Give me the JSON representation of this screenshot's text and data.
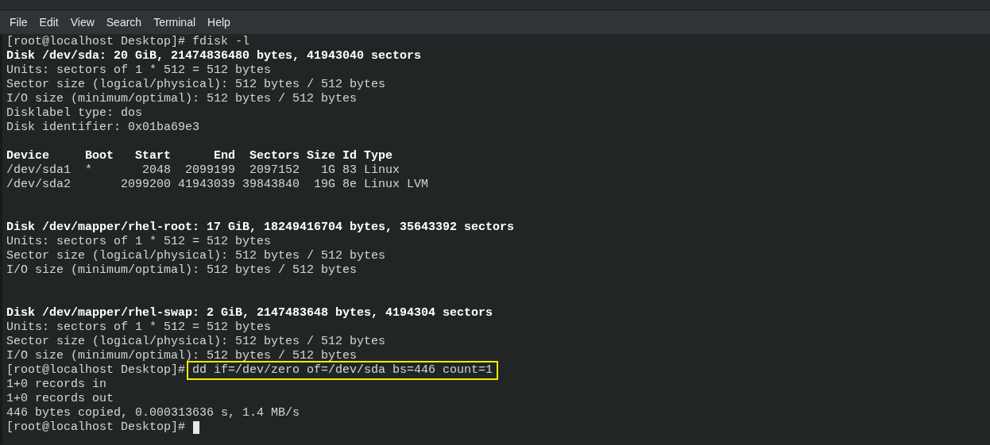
{
  "menu_bar": [
    {
      "label": "File"
    },
    {
      "label": "Edit"
    },
    {
      "label": "View"
    },
    {
      "label": "Search"
    },
    {
      "label": "Terminal"
    },
    {
      "label": "Help"
    }
  ],
  "terminal": {
    "lines": [
      {
        "kind": "prompt",
        "prompt": "[root@localhost Desktop]#",
        "command": "fdisk -l",
        "highlighted": false,
        "cursor": false
      },
      {
        "kind": "bold",
        "text": "Disk /dev/sda: 20 GiB, 21474836480 bytes, 41943040 sectors"
      },
      {
        "kind": "normal",
        "text": "Units: sectors of 1 * 512 = 512 bytes"
      },
      {
        "kind": "normal",
        "text": "Sector size (logical/physical): 512 bytes / 512 bytes"
      },
      {
        "kind": "normal",
        "text": "I/O size (minimum/optimal): 512 bytes / 512 bytes"
      },
      {
        "kind": "normal",
        "text": "Disklabel type: dos"
      },
      {
        "kind": "normal",
        "text": "Disk identifier: 0x01ba69e3"
      },
      {
        "kind": "blank"
      },
      {
        "kind": "bold",
        "text": "Device     Boot   Start      End  Sectors Size Id Type"
      },
      {
        "kind": "normal",
        "text": "/dev/sda1  *       2048  2099199  2097152   1G 83 Linux"
      },
      {
        "kind": "normal",
        "text": "/dev/sda2       2099200 41943039 39843840  19G 8e Linux LVM"
      },
      {
        "kind": "blank"
      },
      {
        "kind": "blank"
      },
      {
        "kind": "bold",
        "text": "Disk /dev/mapper/rhel-root: 17 GiB, 18249416704 bytes, 35643392 sectors"
      },
      {
        "kind": "normal",
        "text": "Units: sectors of 1 * 512 = 512 bytes"
      },
      {
        "kind": "normal",
        "text": "Sector size (logical/physical): 512 bytes / 512 bytes"
      },
      {
        "kind": "normal",
        "text": "I/O size (minimum/optimal): 512 bytes / 512 bytes"
      },
      {
        "kind": "blank"
      },
      {
        "kind": "blank"
      },
      {
        "kind": "bold",
        "text": "Disk /dev/mapper/rhel-swap: 2 GiB, 2147483648 bytes, 4194304 sectors"
      },
      {
        "kind": "normal",
        "text": "Units: sectors of 1 * 512 = 512 bytes"
      },
      {
        "kind": "normal",
        "text": "Sector size (logical/physical): 512 bytes / 512 bytes"
      },
      {
        "kind": "normal",
        "text": "I/O size (minimum/optimal): 512 bytes / 512 bytes"
      },
      {
        "kind": "prompt",
        "prompt": "[root@localhost Desktop]#",
        "command": "dd if=/dev/zero of=/dev/sda bs=446 count=1",
        "highlighted": true,
        "cursor": false
      },
      {
        "kind": "normal",
        "text": "1+0 records in"
      },
      {
        "kind": "normal",
        "text": "1+0 records out"
      },
      {
        "kind": "normal",
        "text": "446 bytes copied, 0.000313636 s, 1.4 MB/s"
      },
      {
        "kind": "prompt",
        "prompt": "[root@localhost Desktop]#",
        "cursor": true
      }
    ]
  }
}
